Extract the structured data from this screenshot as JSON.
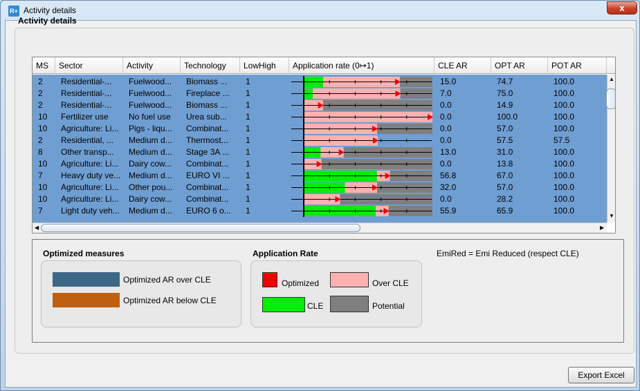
{
  "window": {
    "title": "Activity details",
    "icon": "R+",
    "close_label": "x"
  },
  "section_title": "Activity details",
  "table": {
    "columns": [
      "MS",
      "Sector",
      "Activity",
      "Technology",
      "LowHigh",
      "Application rate (0↦1)",
      "CLE AR",
      "OPT AR",
      "POT AR"
    ],
    "rows": [
      {
        "ms": "2",
        "sector": "Residential-...",
        "activity": "Fuelwood...",
        "technology": "Biomass ...",
        "lowhigh": "1",
        "cle": "15.0",
        "opt": "74.7",
        "pot": "100.0"
      },
      {
        "ms": "2",
        "sector": "Residential-...",
        "activity": "Fuelwood...",
        "technology": "Fireplace ...",
        "lowhigh": "1",
        "cle": "7.0",
        "opt": "75.0",
        "pot": "100.0"
      },
      {
        "ms": "2",
        "sector": "Residential-...",
        "activity": "Fuelwood...",
        "technology": "Biomass ...",
        "lowhigh": "1",
        "cle": "0.0",
        "opt": "14.9",
        "pot": "100.0"
      },
      {
        "ms": "10",
        "sector": "Fertilizer use",
        "activity": "No fuel use",
        "technology": "Urea sub...",
        "lowhigh": "1",
        "cle": "0.0",
        "opt": "100.0",
        "pot": "100.0"
      },
      {
        "ms": "10",
        "sector": "Agriculture: Li...",
        "activity": "Pigs - liqu...",
        "technology": "Combinat...",
        "lowhigh": "1",
        "cle": "0.0",
        "opt": "57.0",
        "pot": "100.0"
      },
      {
        "ms": "2",
        "sector": "Residential, ...",
        "activity": "Medium d...",
        "technology": "Thermost...",
        "lowhigh": "1",
        "cle": "0.0",
        "opt": "57.5",
        "pot": "57.5"
      },
      {
        "ms": "8",
        "sector": "Other transp...",
        "activity": "Medium d...",
        "technology": "Stage 3A ...",
        "lowhigh": "1",
        "cle": "13.0",
        "opt": "31.0",
        "pot": "100.0"
      },
      {
        "ms": "10",
        "sector": "Agriculture: Li...",
        "activity": "Dairy cow...",
        "technology": "Combinat...",
        "lowhigh": "1",
        "cle": "0.0",
        "opt": "13.8",
        "pot": "100.0"
      },
      {
        "ms": "7",
        "sector": "Heavy duty ve...",
        "activity": "Medium d...",
        "technology": "EURO VI ...",
        "lowhigh": "1",
        "cle": "56.8",
        "opt": "67.0",
        "pot": "100.0"
      },
      {
        "ms": "10",
        "sector": "Agriculture: Li...",
        "activity": "Other pou...",
        "technology": "Combinat...",
        "lowhigh": "1",
        "cle": "32.0",
        "opt": "57.0",
        "pot": "100.0"
      },
      {
        "ms": "10",
        "sector": "Agriculture: Li...",
        "activity": "Dairy cow...",
        "technology": "Combinat...",
        "lowhigh": "1",
        "cle": "0.0",
        "opt": "28.2",
        "pot": "100.0"
      },
      {
        "ms": "7",
        "sector": "Light duty veh...",
        "activity": "Medium d...",
        "technology": "EURO 6 o...",
        "lowhigh": "1",
        "cle": "55.9",
        "opt": "65.9",
        "pot": "100.0"
      }
    ]
  },
  "colors": {
    "row_bg": "#6f9ed2",
    "cle": "#00ee00",
    "over_cle": "#ffb0b0",
    "potential": "#7f7f7f",
    "optimized": "#ee0000",
    "opt_over": "#3d6787",
    "opt_below": "#bf6010"
  },
  "legend": {
    "optimized_measures": {
      "title": "Optimized measures",
      "over_label": "Optimized AR over CLE",
      "below_label": "Optimized AR below CLE"
    },
    "application_rate": {
      "title": "Application Rate",
      "optimized_label": "Optimized",
      "over_cle_label": "Over CLE",
      "cle_label": "CLE",
      "potential_label": "Potential"
    },
    "emired_note": "EmiRed = Emi Reduced (respect CLE)"
  },
  "export_button": "Export Excel"
}
